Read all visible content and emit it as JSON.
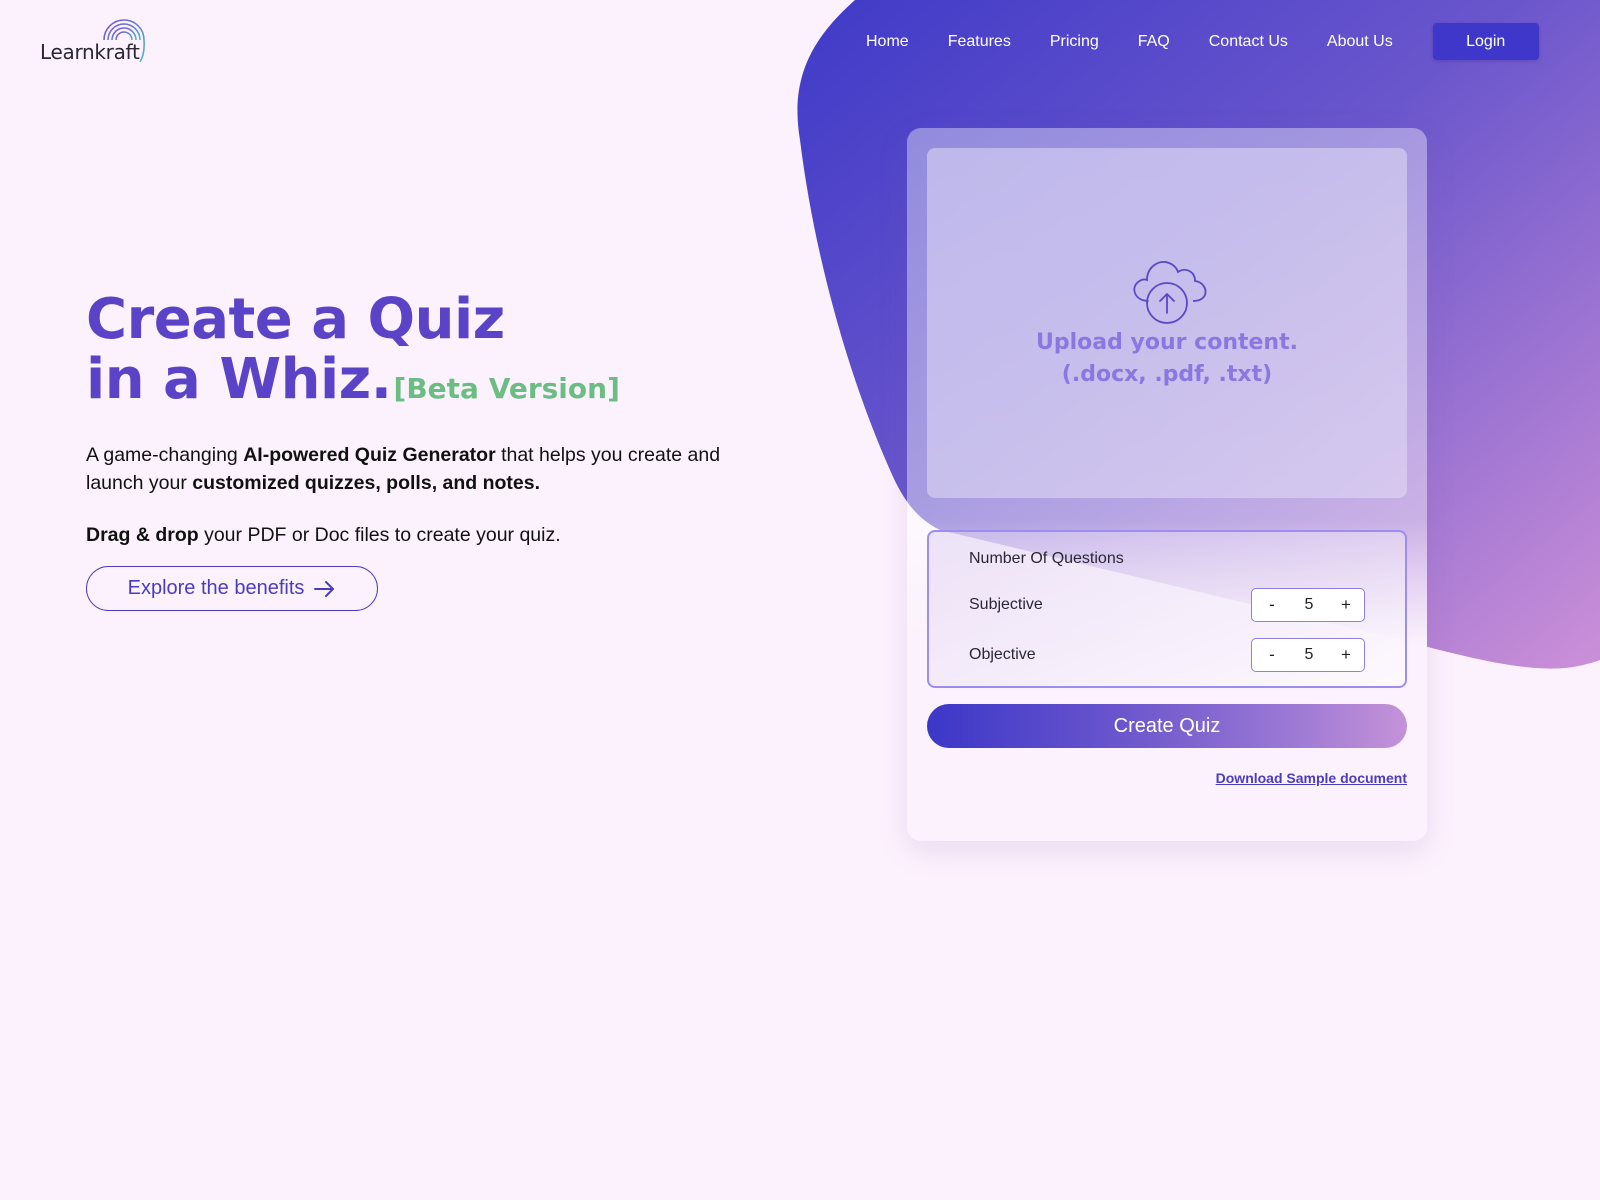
{
  "brand": {
    "name": "Learnkraft",
    "colors": {
      "primary": "#5b43c8",
      "accent_green": "#6bbd84",
      "login_bg": "#3f37c9",
      "background": "#fcf2fd"
    }
  },
  "nav": {
    "links": [
      {
        "label": "Home"
      },
      {
        "label": "Features"
      },
      {
        "label": "Pricing"
      },
      {
        "label": "FAQ"
      },
      {
        "label": "Contact Us"
      },
      {
        "label": "About Us"
      }
    ],
    "login_label": "Login"
  },
  "hero": {
    "title_line1": "Create a Quiz",
    "title_line2": "in a Whiz.",
    "beta_tag": "[Beta Version]",
    "desc_part1": "A game-changing ",
    "desc_bold1": "AI-powered Quiz Generator",
    "desc_part2": " that helps you create and launch your ",
    "desc_bold2": "customized quizzes, polls, and notes.",
    "drag_bold": "Drag & drop",
    "drag_rest": " your PDF or Doc files to create your quiz.",
    "explore_label": "Explore the benefits",
    "explore_icon": "arrow-right-icon"
  },
  "card": {
    "upload_icon": "cloud-upload-icon",
    "upload_title": "Upload your content.",
    "upload_formats": "(.docx, .pdf, .txt)",
    "questions_heading": "Number Of Questions",
    "rows": [
      {
        "label": "Subjective",
        "value": "5",
        "dec": "-",
        "inc": "+"
      },
      {
        "label": "Objective",
        "value": "5",
        "dec": "-",
        "inc": "+"
      }
    ],
    "create_label": "Create Quiz",
    "download_label": "Download Sample document"
  }
}
